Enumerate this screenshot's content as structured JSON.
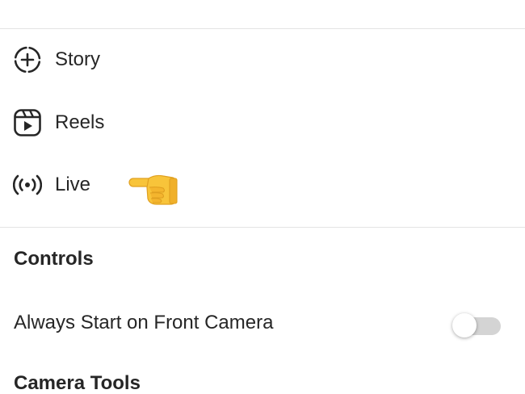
{
  "menu": {
    "items": [
      {
        "label": "Story",
        "icon": "story-add-icon"
      },
      {
        "label": "Reels",
        "icon": "reels-icon"
      },
      {
        "label": "Live",
        "icon": "live-broadcast-icon"
      }
    ],
    "pointer_icon": "backhand-index-pointing-left-emoji"
  },
  "controls": {
    "title": "Controls",
    "front_camera": {
      "label": "Always Start on Front Camera",
      "enabled": false
    }
  },
  "camera_tools": {
    "title": "Camera Tools"
  },
  "colors": {
    "text": "#262626",
    "divider": "#e3e3e3",
    "toggle_track_off": "#d4d4d4",
    "emoji_yellow": "#f8c43a"
  }
}
